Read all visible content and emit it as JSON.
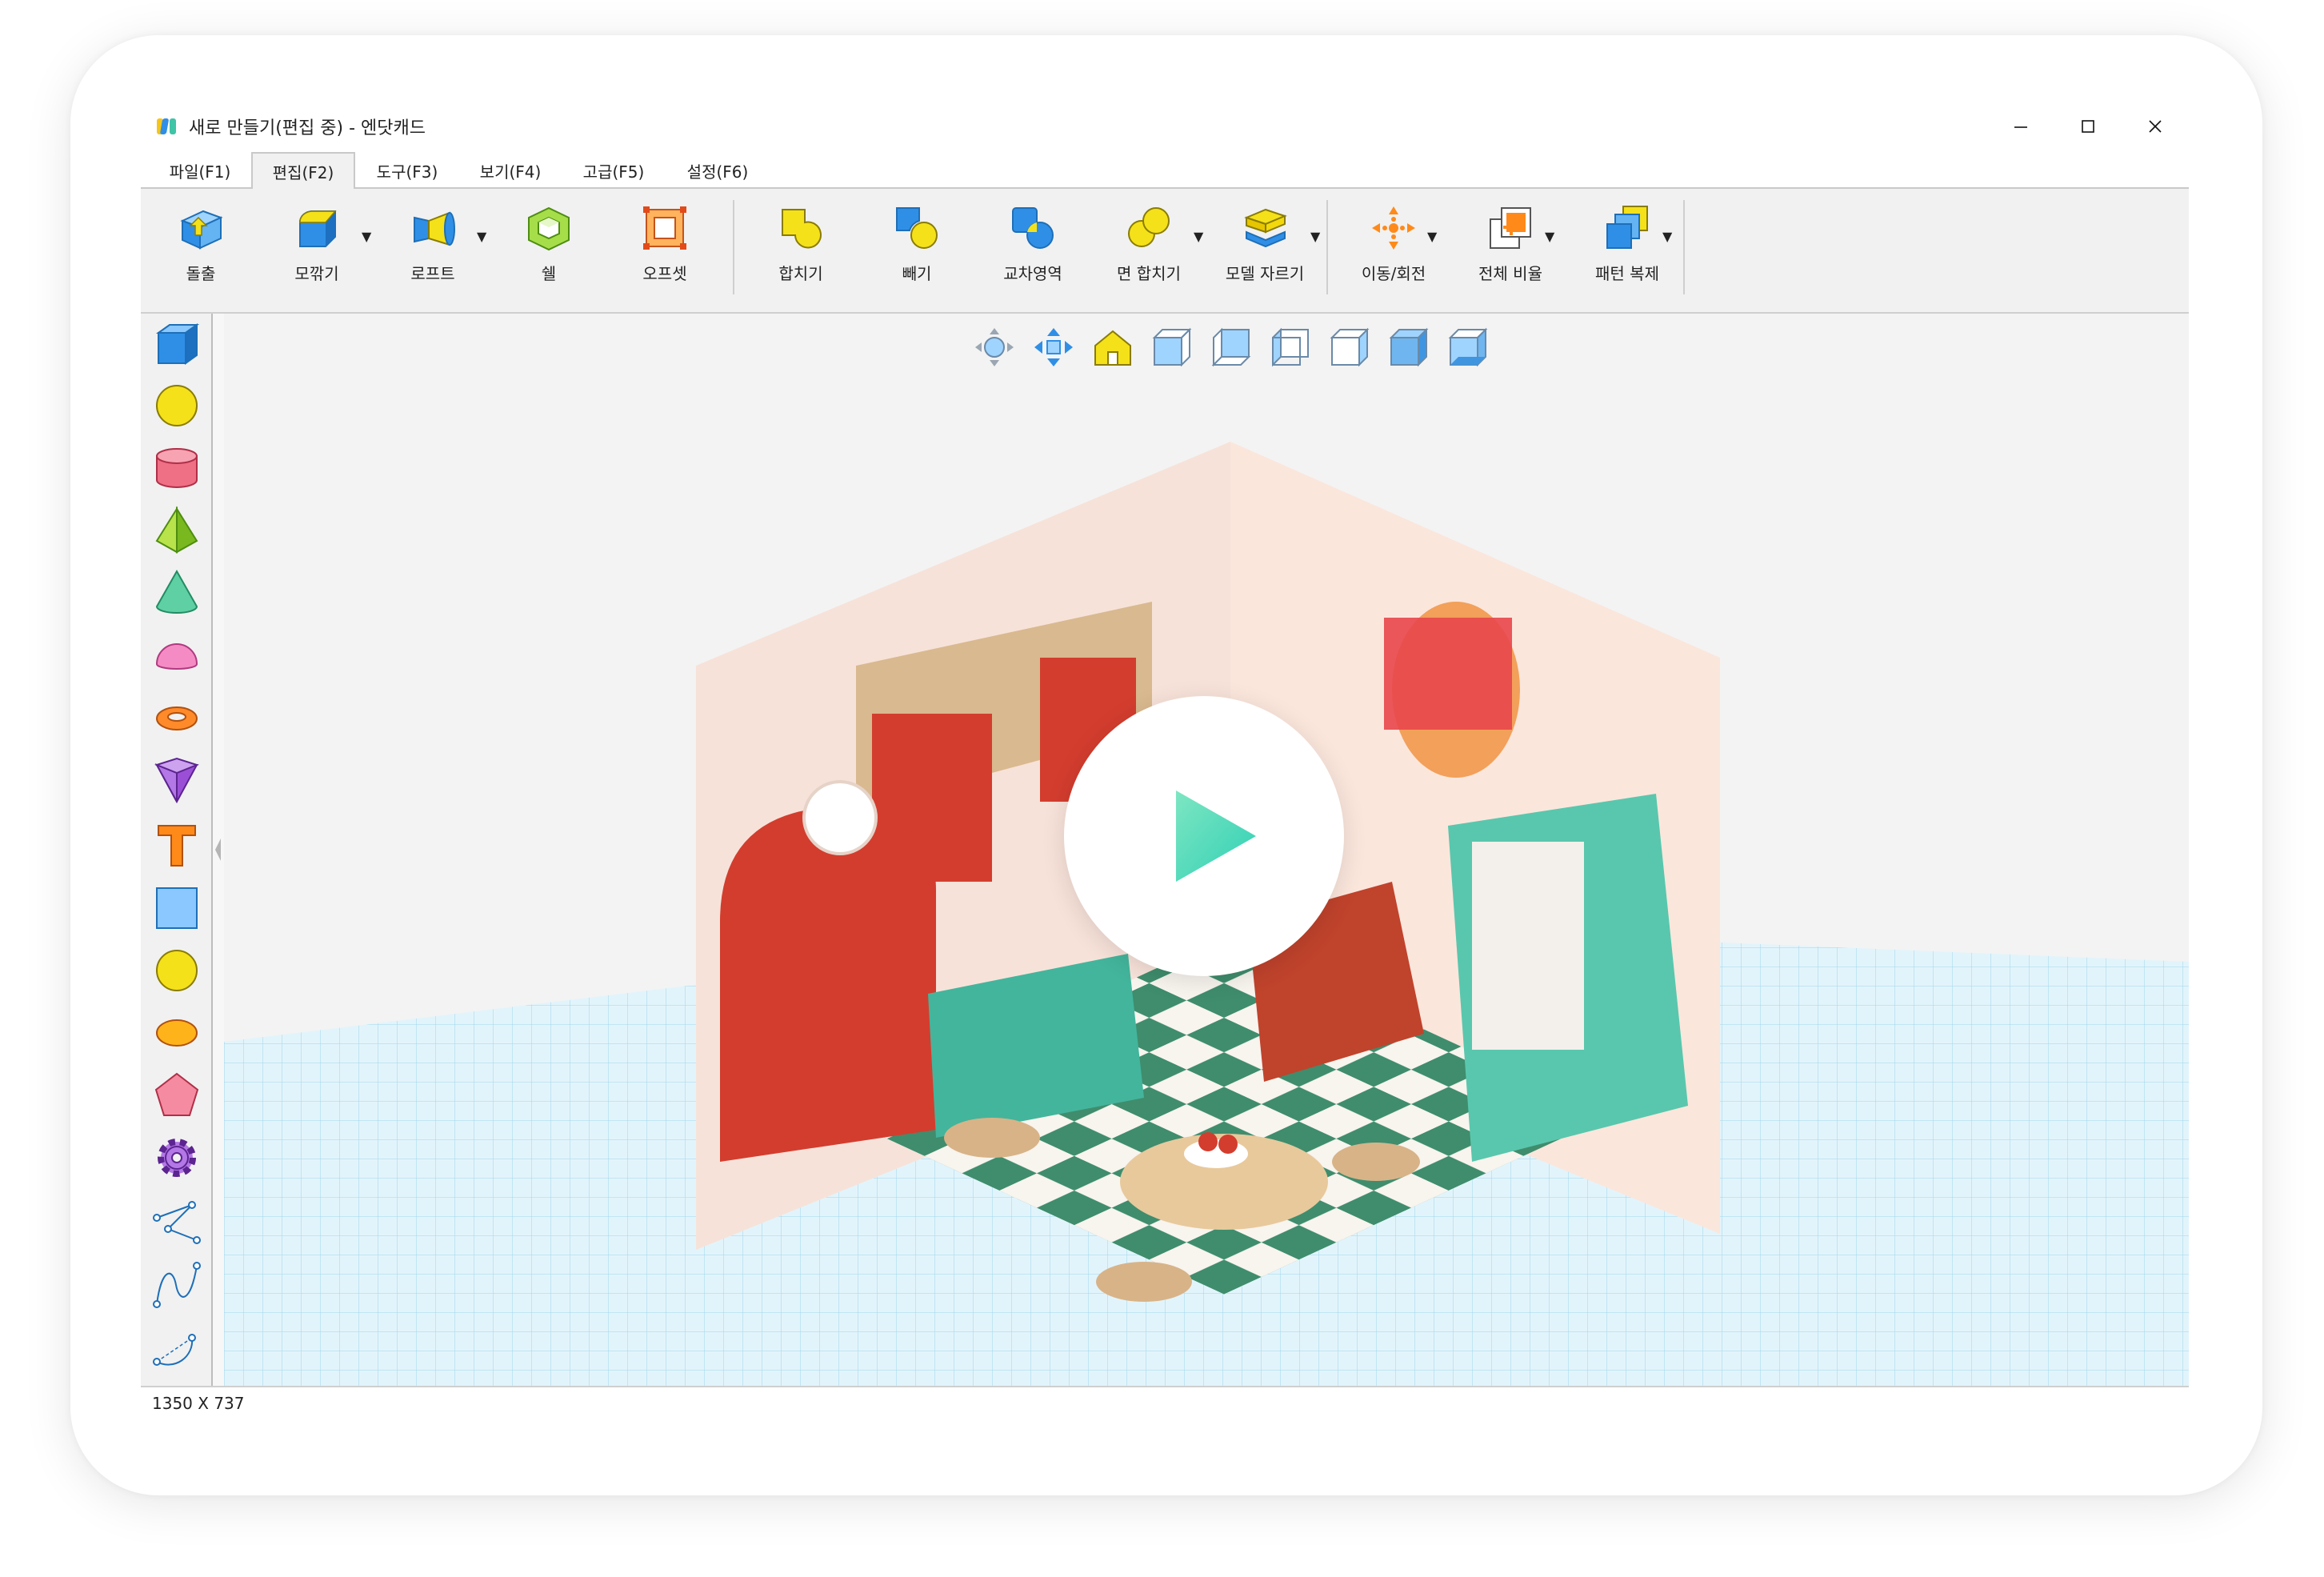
{
  "window": {
    "title": "새로 만들기(편집 중) - 엔닷캐드",
    "controls": [
      "minimize",
      "maximize",
      "close"
    ]
  },
  "menus": [
    {
      "label": "파일(F1)",
      "active": false
    },
    {
      "label": "편집(F2)",
      "active": true
    },
    {
      "label": "도구(F3)",
      "active": false
    },
    {
      "label": "보기(F4)",
      "active": false
    },
    {
      "label": "고급(F5)",
      "active": false
    },
    {
      "label": "설정(F6)",
      "active": false
    }
  ],
  "toolbar": [
    {
      "label": "돌출",
      "icon": "extrude-icon"
    },
    {
      "label": "모깎기",
      "icon": "fillet-icon",
      "dropdown": true
    },
    {
      "label": "로프트",
      "icon": "loft-icon",
      "dropdown": true
    },
    {
      "label": "쉘",
      "icon": "shell-icon"
    },
    {
      "label": "오프셋",
      "icon": "offset-icon"
    },
    {
      "label": "합치기",
      "icon": "union-icon"
    },
    {
      "label": "빼기",
      "icon": "subtract-icon"
    },
    {
      "label": "교차영역",
      "icon": "intersect-icon"
    },
    {
      "label": "면 합치기",
      "icon": "face-union-icon",
      "dropdown": true
    },
    {
      "label": "모델 자르기",
      "icon": "model-cut-icon",
      "dropdown": true
    },
    {
      "label": "이동/회전",
      "icon": "move-rotate-icon",
      "dropdown": true
    },
    {
      "label": "전체 비율",
      "icon": "scale-icon",
      "dropdown": true
    },
    {
      "label": "패턴 복제",
      "icon": "pattern-copy-icon",
      "dropdown": true
    }
  ],
  "shapes": [
    "cube-icon",
    "sphere-icon",
    "cylinder-icon",
    "pyramid-icon",
    "cone-icon",
    "hemisphere-icon",
    "torus-icon",
    "wedge-icon",
    "text-icon",
    "rectangle-icon",
    "circle-icon",
    "ellipse-icon",
    "pentagon-icon",
    "gear-icon",
    "polyline-icon",
    "curve-icon",
    "arc-icon"
  ],
  "view_icons": [
    "orbit-icon",
    "pan-icon",
    "home-view-icon",
    "front-view-icon",
    "back-view-icon",
    "left-view-icon",
    "right-view-icon",
    "top-view-icon",
    "bottom-view-icon"
  ],
  "status": {
    "size": "1350 X 737"
  },
  "colors": {
    "accent_blue": "#2f8fe6",
    "yellow": "#f5e11a",
    "red": "#e0352b",
    "teal": "#3fc4a6"
  }
}
